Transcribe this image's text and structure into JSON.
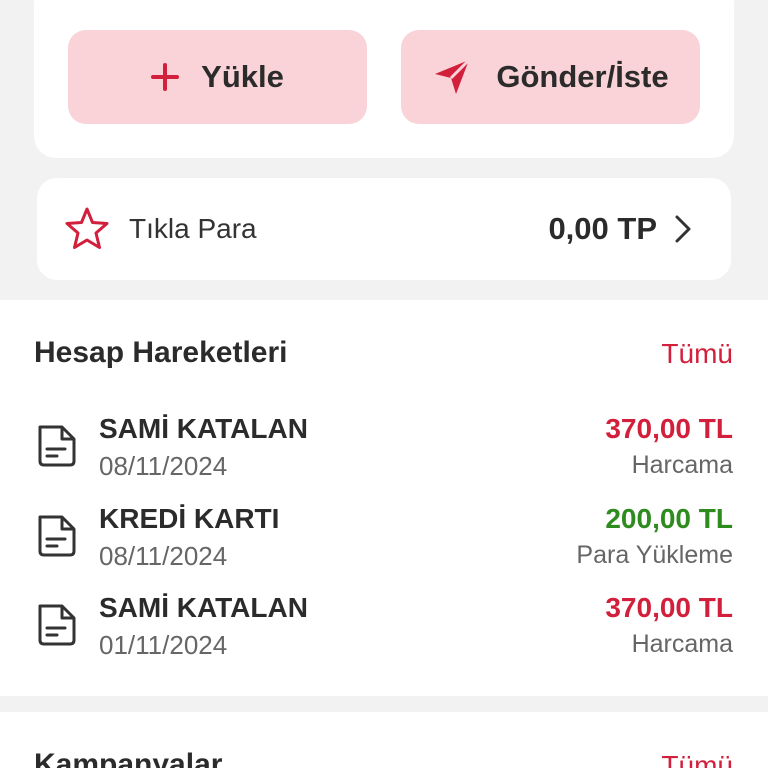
{
  "actions": {
    "load_label": "Yükle",
    "send_label": "Gönder/İste"
  },
  "tikla_para": {
    "label": "Tıkla Para",
    "value": "0,00 TP"
  },
  "transactions": {
    "title": "Hesap Hareketleri",
    "see_all": "Tümü",
    "items": [
      {
        "name": "SAMİ KATALAN",
        "date": "08/11/2024",
        "amount": "370,00 TL",
        "type": "Harcama"
      },
      {
        "name": "KREDİ KARTI",
        "date": "08/11/2024",
        "amount": "200,00 TL",
        "type": "Para Yükleme"
      },
      {
        "name": "SAMİ KATALAN",
        "date": "01/11/2024",
        "amount": "370,00 TL",
        "type": "Harcama"
      }
    ]
  },
  "campaigns": {
    "title": "Kampanyalar",
    "see_all": "Tümü"
  },
  "colors": {
    "accent": "#d21f3c",
    "button_bg": "#f9d3d7",
    "expense": "#d21f3c",
    "income": "#2e8b1e"
  },
  "icons": {
    "load": "plus-icon",
    "send": "send-icon",
    "tikla": "star-icon",
    "chevron": "chevron-right-icon",
    "transaction": "document-icon"
  }
}
